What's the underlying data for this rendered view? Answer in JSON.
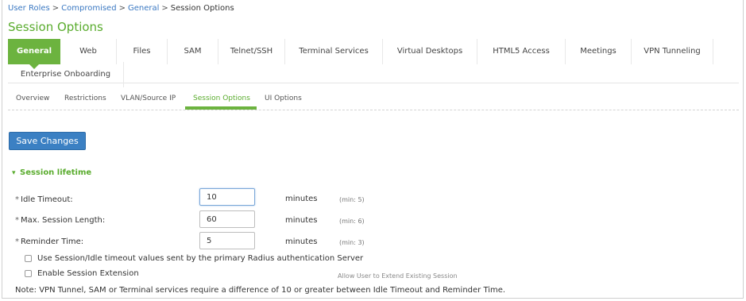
{
  "breadcrumb": {
    "items": [
      "User Roles",
      "Compromised",
      "General"
    ],
    "current": "Session Options",
    "separator": ">"
  },
  "page_title": "Session Options",
  "tabs": [
    {
      "label": "General",
      "active": true
    },
    {
      "label": "Web",
      "active": false
    },
    {
      "label": "Files",
      "active": false
    },
    {
      "label": "SAM",
      "active": false
    },
    {
      "label": "Telnet/SSH",
      "active": false
    },
    {
      "label": "Terminal Services",
      "active": false
    },
    {
      "label": "Virtual Desktops",
      "active": false
    },
    {
      "label": "HTML5 Access",
      "active": false
    },
    {
      "label": "Meetings",
      "active": false
    },
    {
      "label": "VPN Tunneling",
      "active": false
    },
    {
      "label": "Enterprise Onboarding",
      "active": false
    }
  ],
  "subtabs": [
    {
      "label": "Overview",
      "active": false
    },
    {
      "label": "Restrictions",
      "active": false
    },
    {
      "label": "VLAN/Source IP",
      "active": false
    },
    {
      "label": "Session Options",
      "active": true
    },
    {
      "label": "UI Options",
      "active": false
    }
  ],
  "save_button": "Save Changes",
  "section": {
    "title": "Session lifetime",
    "chevron_icon": "chevron-down-icon"
  },
  "fields": [
    {
      "required_mark": "*",
      "label": "Idle Timeout:",
      "value": "10",
      "unit": "minutes",
      "hint": "(min: 5)"
    },
    {
      "required_mark": "*",
      "label": "Max. Session Length:",
      "value": "60",
      "unit": "minutes",
      "hint": "(min: 6)"
    },
    {
      "required_mark": "*",
      "label": "Reminder Time:",
      "value": "5",
      "unit": "minutes",
      "hint": "(min: 3)"
    }
  ],
  "checkboxes": [
    {
      "label": "Use Session/Idle timeout values sent by the primary Radius authentication Server",
      "checked": false
    },
    {
      "label": "Enable Session Extension",
      "checked": false
    }
  ],
  "extension_note": "Allow User to Extend Existing Session",
  "footnote": "Note: VPN Tunnel, SAM or Terminal services require a difference of 10 or greater between Idle Timeout and Reminder Time.",
  "colors": {
    "accent_green": "#6cb33f",
    "title_green": "#5aac2e",
    "button_blue": "#3b80c3",
    "link_blue": "#3a78c2"
  }
}
